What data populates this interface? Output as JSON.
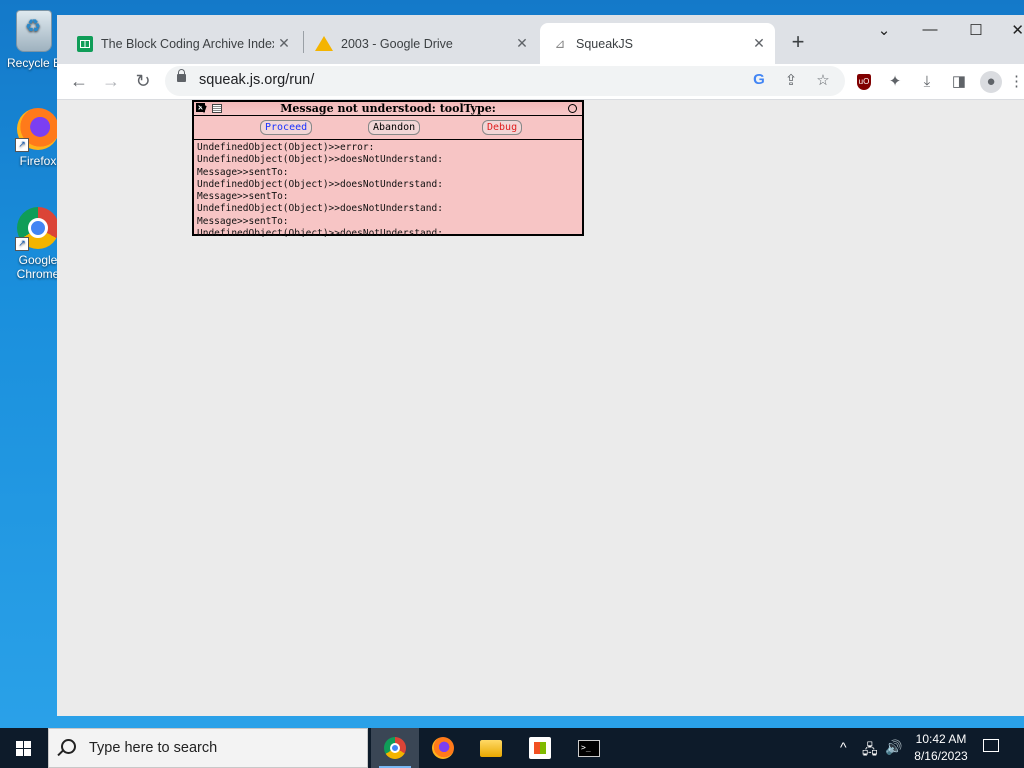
{
  "desktop": {
    "icons": [
      {
        "label": "Recycle Bin",
        "display": "Recycle B"
      },
      {
        "label": "Firefox"
      },
      {
        "label": "Google Chrome",
        "line1": "Google",
        "line2": "Chrome"
      }
    ]
  },
  "browser": {
    "tabs": [
      {
        "title": "The Block Coding Archive Index",
        "close": "✕"
      },
      {
        "title": "2003 - Google Drive",
        "close": "✕"
      },
      {
        "title": "SqueakJS",
        "close": "✕"
      }
    ],
    "new_tab": "+",
    "window_controls": {
      "dropdown": "⌄",
      "minimize": "—",
      "maximize": "☐",
      "close": "✕"
    },
    "nav": {
      "back": "←",
      "forward": "→",
      "reload": "↻"
    },
    "omnibox": {
      "url": "squeak.js.org/run/"
    },
    "toolbar_icons": [
      "google-lens-icon",
      "share-icon",
      "bookmark-star-icon",
      "ublock-icon",
      "extensions-icon",
      "download-icon",
      "side-panel-icon",
      "profile-icon",
      "menu-icon"
    ]
  },
  "notifier": {
    "title": "Message not understood: toolType:",
    "buttons": {
      "proceed": "Proceed",
      "abandon": "Abandon",
      "debug": "Debug"
    },
    "colors": {
      "proceed": "#1a33ff",
      "abandon": "#000000",
      "debug": "#e02020",
      "background": "#f7c5c5"
    },
    "stack": [
      "UndefinedObject(Object)>>error:",
      "UndefinedObject(Object)>>doesNotUnderstand:",
      "Message>>sentTo:",
      "UndefinedObject(Object)>>doesNotUnderstand:",
      "Message>>sentTo:",
      "UndefinedObject(Object)>>doesNotUnderstand:",
      "Message>>sentTo:",
      "UndefinedObject(Object)>>doesNotUnderstand:"
    ]
  },
  "taskbar": {
    "search_placeholder": "Type here to search",
    "apps": [
      "Google Chrome",
      "Firefox",
      "File Explorer",
      "Microsoft Store",
      "Terminal"
    ],
    "tray": {
      "chevron": "^",
      "network": "🖧",
      "volume": "🔊"
    },
    "time": "10:42 AM",
    "date": "8/16/2023"
  }
}
